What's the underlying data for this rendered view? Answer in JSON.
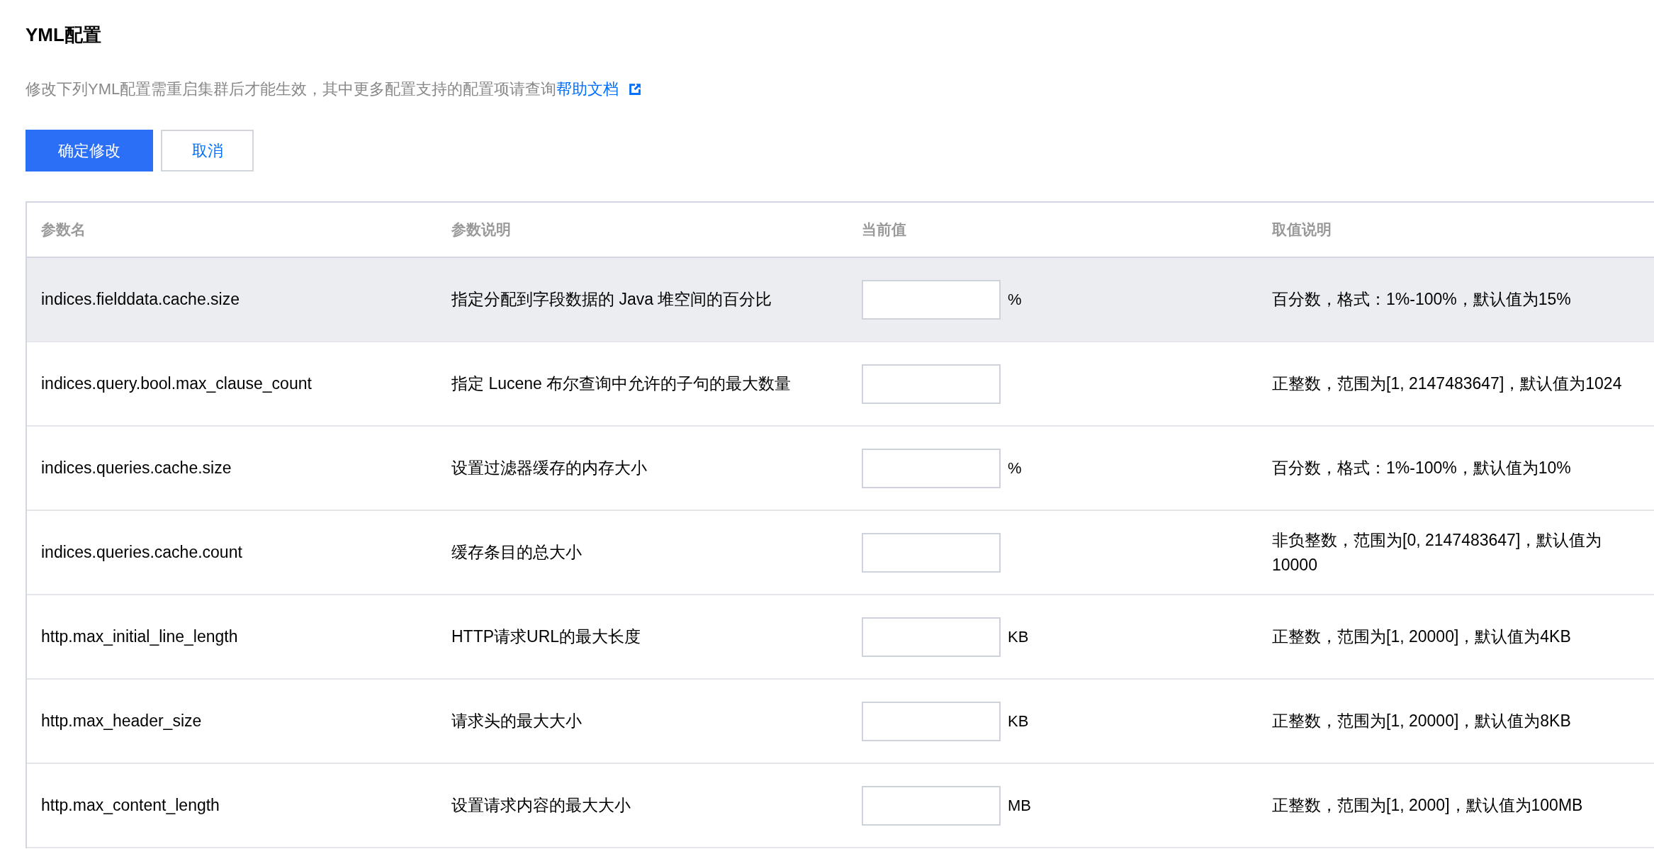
{
  "title": "YML配置",
  "description": {
    "text": "修改下列YML配置需重启集群后才能生效，其中更多配置支持的配置项请查询",
    "link": "帮助文档"
  },
  "buttons": [
    {
      "label": "确定修改",
      "kind": "primary"
    },
    {
      "label": "取消",
      "kind": "secondary"
    }
  ],
  "table": {
    "columns": [
      "参数名",
      "参数说明",
      "当前值",
      "取值说明"
    ],
    "rows": [
      {
        "name": "indices.fielddata.cache.size",
        "description": "指定分配到字段数据的 Java 堆空间的百分比",
        "unit": "%",
        "range": "百分数，格式：1%-100%，默认值为15%",
        "highlighted": true
      },
      {
        "name": "indices.query.bool.max_clause_count",
        "description": "指定 Lucene 布尔查询中允许的子句的最大数量",
        "range": "正整数，范围为[1, 2147483647]，默认值为1024",
        "highlighted": false
      },
      {
        "name": "indices.queries.cache.size",
        "description": "设置过滤器缓存的内存大小",
        "unit": "%",
        "range": "百分数，格式：1%-100%，默认值为10%",
        "highlighted": false
      },
      {
        "name": "indices.queries.cache.count",
        "description": "缓存条目的总大小",
        "range": "非负整数，范围为[0, 2147483647]，默认值为10000",
        "highlighted": false
      },
      {
        "name": "http.max_initial_line_length",
        "description": "HTTP请求URL的最大长度",
        "unit": "KB",
        "range": "正整数，范围为[1, 20000]，默认值为4KB",
        "highlighted": false
      },
      {
        "name": "http.max_header_size",
        "description": "请求头的最大大小",
        "unit": "KB",
        "range": "正整数，范围为[1, 20000]，默认值为8KB",
        "highlighted": false
      },
      {
        "name": "http.max_content_length",
        "description": "设置请求内容的最大大小",
        "unit": "MB",
        "range": "正整数，范围为[1, 2000]，默认值为100MB",
        "highlighted": false
      }
    ]
  }
}
